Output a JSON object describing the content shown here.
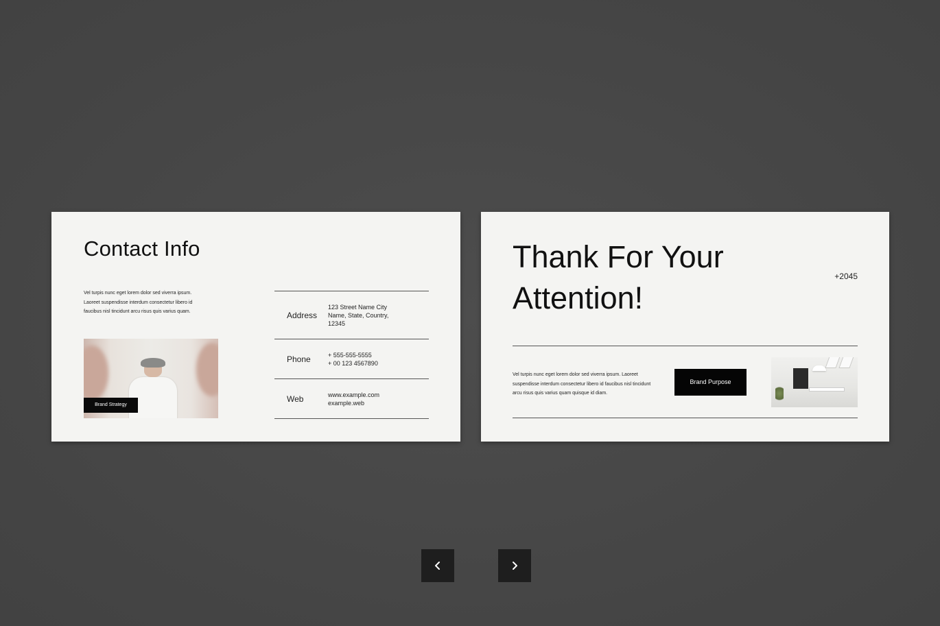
{
  "slides": {
    "contact": {
      "title": "Contact Info",
      "body": "Vel turpis nunc eget lorem dolor sed viverra ipsum. Laoreet suspendisse interdum consectetur libero id faucibus nisl tincidunt arcu risus quis varius quam.",
      "photo_tag": "Brand Strategy",
      "rows": [
        {
          "label": "Address",
          "value_lines": [
            "123 Street Name City",
            "Name, State, Country,",
            "12345"
          ]
        },
        {
          "label": "Phone",
          "value_lines": [
            "+ 555-555-5555",
            "+ 00 123 4567890"
          ]
        },
        {
          "label": "Web",
          "value_lines": [
            "www.example.com",
            "example.web"
          ]
        }
      ]
    },
    "thanks": {
      "title_line1": "Thank For Your",
      "title_line2": "Attention!",
      "year": "+2045",
      "body": "Vel turpis nunc eget lorem dolor sed viverra ipsum. Laoreet suspendisse interdum consectetur libero id faucibus nisl tincidunt arcu risus quis varius quam quisque id diam.",
      "cta_label": "Brand Purpose"
    }
  },
  "nav": {
    "prev_icon": "chevron-left-icon",
    "next_icon": "chevron-right-icon"
  },
  "colors": {
    "background": "#4a4a4a",
    "slide": "#f4f4f2",
    "ink": "#111111",
    "button": "#1e1e1e"
  }
}
